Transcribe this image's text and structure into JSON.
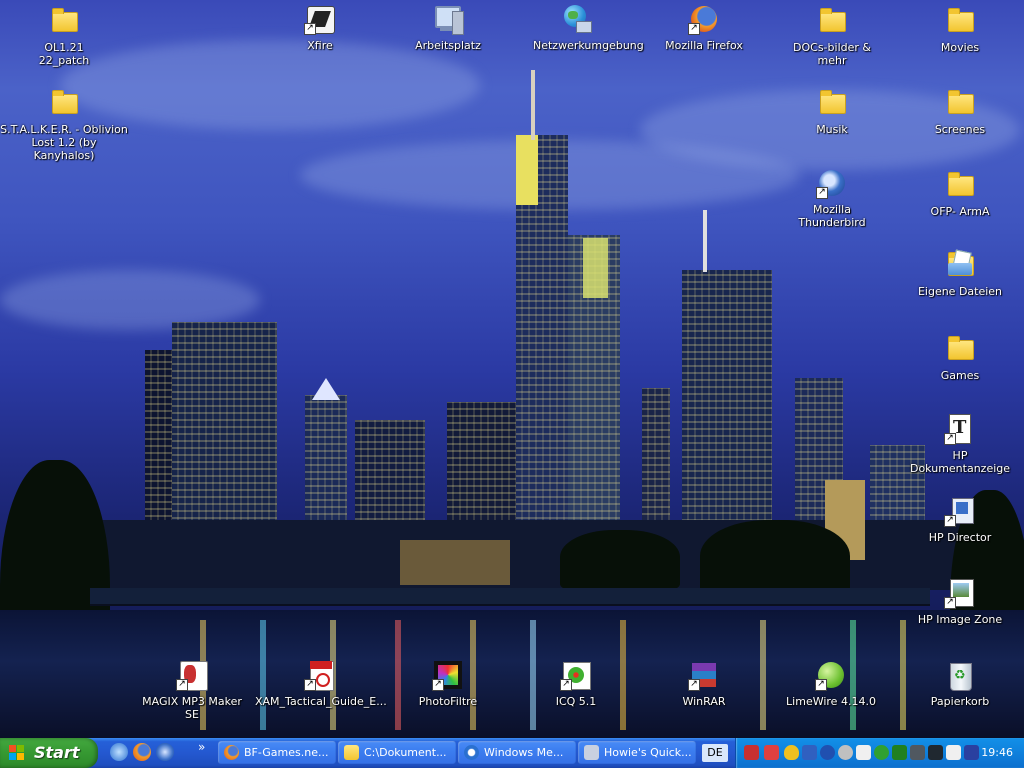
{
  "desktop": {
    "icons": [
      {
        "id": "ol-patch",
        "label": "OL1.21 22_patch",
        "type": "folder",
        "shortcut": false
      },
      {
        "id": "xfire",
        "label": "Xfire",
        "type": "app",
        "shortcut": true,
        "color": "#ffffff"
      },
      {
        "id": "arbeitsplatz",
        "label": "Arbeitsplatz",
        "type": "computer",
        "shortcut": false
      },
      {
        "id": "netzwerk",
        "label": "Netzwerkumgebung",
        "type": "network",
        "shortcut": false
      },
      {
        "id": "firefox",
        "label": "Mozilla Firefox",
        "type": "app",
        "shortcut": true,
        "color": "#e8641c"
      },
      {
        "id": "docs",
        "label": "DOCs-bilder & mehr",
        "type": "folder",
        "shortcut": false
      },
      {
        "id": "movies",
        "label": "Movies",
        "type": "folder",
        "shortcut": false
      },
      {
        "id": "stalker",
        "label_line1": "S.T.A.L.K.E.R. - Oblivion",
        "label_line2": "Lost 1.2 (by Kanyhalos)",
        "type": "folder",
        "shortcut": false
      },
      {
        "id": "musik",
        "label": "Musik",
        "type": "folder",
        "shortcut": false
      },
      {
        "id": "screenes",
        "label": "Screenes",
        "type": "folder",
        "shortcut": false
      },
      {
        "id": "thunderbird",
        "label": "Mozilla Thunderbird",
        "type": "app",
        "shortcut": true,
        "color": "#3a6fc8"
      },
      {
        "id": "ofp",
        "label": "OFP- ArmA",
        "type": "folder",
        "shortcut": false
      },
      {
        "id": "eigene",
        "label": "Eigene Dateien",
        "type": "documents",
        "shortcut": false
      },
      {
        "id": "games",
        "label": "Games",
        "type": "folder",
        "shortcut": false
      },
      {
        "id": "hp-doc",
        "label": "HP Dokumentanzeige",
        "type": "app",
        "shortcut": true
      },
      {
        "id": "hp-director",
        "label": "HP Director",
        "type": "app",
        "shortcut": true
      },
      {
        "id": "hp-image",
        "label": "HP  Image Zone",
        "type": "app",
        "shortcut": true
      },
      {
        "id": "magix",
        "label": "MAGIX MP3 Maker SE",
        "type": "app",
        "shortcut": true
      },
      {
        "id": "xam",
        "label": "XAM_Tactical_Guide_E...",
        "type": "pdf",
        "shortcut": true
      },
      {
        "id": "photofiltre",
        "label": "PhotoFiltre",
        "type": "app",
        "shortcut": true
      },
      {
        "id": "icq",
        "label": "ICQ 5.1",
        "type": "app",
        "shortcut": true
      },
      {
        "id": "winrar",
        "label": "WinRAR",
        "type": "app",
        "shortcut": true
      },
      {
        "id": "limewire",
        "label": "LimeWire 4.14.0",
        "type": "app",
        "shortcut": true
      },
      {
        "id": "papierkorb",
        "label": "Papierkorb",
        "type": "recycle",
        "shortcut": false
      }
    ]
  },
  "taskbar": {
    "start_label": "Start",
    "quicklaunch_more": "»",
    "tasks": [
      {
        "label": "BF-Games.ne...",
        "icon": "firefox-icon"
      },
      {
        "label": "C:\\Dokument...",
        "icon": "folder-icon"
      },
      {
        "label": "Windows Me...",
        "icon": "media-player-icon"
      },
      {
        "label": "Howie's Quick...",
        "icon": "app-icon"
      }
    ],
    "language": "DE",
    "clock": "19:46"
  }
}
